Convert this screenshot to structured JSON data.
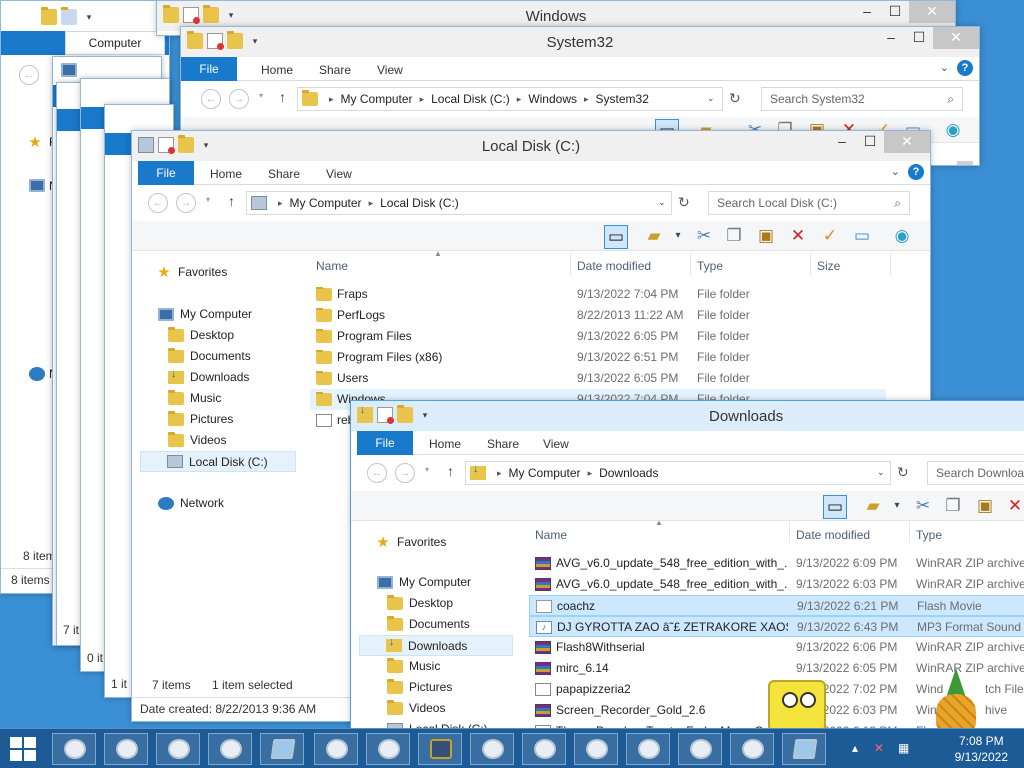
{
  "windows_win": {
    "title": "Windows"
  },
  "back_win": {
    "tab_label": "Computer",
    "status_items_a": "8 item",
    "status_items_b": "8 items",
    "frag_7a": "7",
    "frag_7b": "7 it",
    "frag_0": "0 it",
    "frag_1": "1 it",
    "side_f": "F",
    "side_n": "N",
    "side_n2": "N"
  },
  "system32": {
    "title": "System32",
    "tabs": [
      "File",
      "Home",
      "Share",
      "View"
    ],
    "path": [
      "My Computer",
      "Local Disk (C:)",
      "Windows",
      "System32"
    ],
    "search_placeholder": "Search System32"
  },
  "localdisk": {
    "title": "Local Disk (C:)",
    "tabs": [
      "File",
      "Home",
      "Share",
      "View"
    ],
    "path": [
      "My Computer",
      "Local Disk (C:)"
    ],
    "search_placeholder": "Search Local Disk (C:)",
    "nav": {
      "favorites": "Favorites",
      "my_computer": "My Computer",
      "items": [
        "Desktop",
        "Documents",
        "Downloads",
        "Music",
        "Pictures",
        "Videos",
        "Local Disk (C:)"
      ],
      "network": "Network"
    },
    "columns": [
      "Name",
      "Date modified",
      "Type",
      "Size"
    ],
    "files": [
      {
        "name": "Fraps",
        "date": "9/13/2022 7:04 PM",
        "type": "File folder"
      },
      {
        "name": "PerfLogs",
        "date": "8/22/2013 11:22 AM",
        "type": "File folder"
      },
      {
        "name": "Program Files",
        "date": "9/13/2022 6:05 PM",
        "type": "File folder"
      },
      {
        "name": "Program Files (x86)",
        "date": "9/13/2022 6:51 PM",
        "type": "File folder"
      },
      {
        "name": "Users",
        "date": "9/13/2022 6:05 PM",
        "type": "File folder"
      },
      {
        "name": "Windows",
        "date": "9/13/2022 7:04 PM",
        "type": "File folder"
      },
      {
        "name": "reb",
        "date": "",
        "type": ""
      }
    ],
    "status_count": "7 items",
    "status_selected": "1 item selected",
    "status_created": "Date created: 8/22/2013 9:36 AM"
  },
  "downloads": {
    "title": "Downloads",
    "tabs": [
      "File",
      "Home",
      "Share",
      "View"
    ],
    "path": [
      "My Computer",
      "Downloads"
    ],
    "search_placeholder": "Search Download",
    "nav": {
      "favorites": "Favorites",
      "my_computer": "My Computer",
      "items": [
        "Desktop",
        "Documents",
        "Downloads",
        "Music",
        "Pictures",
        "Videos",
        "Local Disk (C:)"
      ]
    },
    "columns": [
      "Name",
      "Date modified",
      "Type"
    ],
    "files": [
      {
        "name": "AVG_v6.0_update_548_free_edition_with_...",
        "date": "9/13/2022 6:09 PM",
        "type": "WinRAR ZIP archive",
        "icon": "rar"
      },
      {
        "name": "AVG_v6.0_update_548_free_edition_with_...",
        "date": "9/13/2022 6:03 PM",
        "type": "WinRAR ZIP archive",
        "icon": "rar"
      },
      {
        "name": "coachz",
        "date": "9/13/2022 6:21 PM",
        "type": "Flash Movie",
        "icon": "swf"
      },
      {
        "name": "DJ GYROTTA ZAO â˜£ ZETRAKORE XAOS ...",
        "date": "9/13/2022 6:43 PM",
        "type": "MP3 Format Sound",
        "icon": "mp3"
      },
      {
        "name": "Flash8Withserial",
        "date": "9/13/2022 6:06 PM",
        "type": "WinRAR ZIP archive",
        "icon": "rar"
      },
      {
        "name": "mirc_6.14",
        "date": "9/13/2022 6:05 PM",
        "type": "WinRAR ZIP archive",
        "icon": "rar"
      },
      {
        "name": "papapizzeria2",
        "date": "9/13/2022 7:02 PM",
        "type": "Wind",
        "type_tail": "tch File",
        "icon": "file"
      },
      {
        "name": "Screen_Recorder_Gold_2.6",
        "date": "9/13/2022 6:03 PM",
        "type": "Win",
        "type_tail": "hive",
        "icon": "rar"
      },
      {
        "name": "These_Peoples_Try_to_Fade_Me_-_Coach...",
        "date": "9/13/2022 6:13 PM",
        "type": "Fla",
        "icon": "file"
      }
    ],
    "frag_last": "These_Peoples_Try_to_Fade"
  },
  "taskbar": {
    "clock_time": "7:08 PM",
    "clock_date": "9/13/2022"
  },
  "icons": {
    "help": "?",
    "search": "⌕",
    "refresh": "↻",
    "up": "↑",
    "back": "←",
    "forward": "→"
  }
}
